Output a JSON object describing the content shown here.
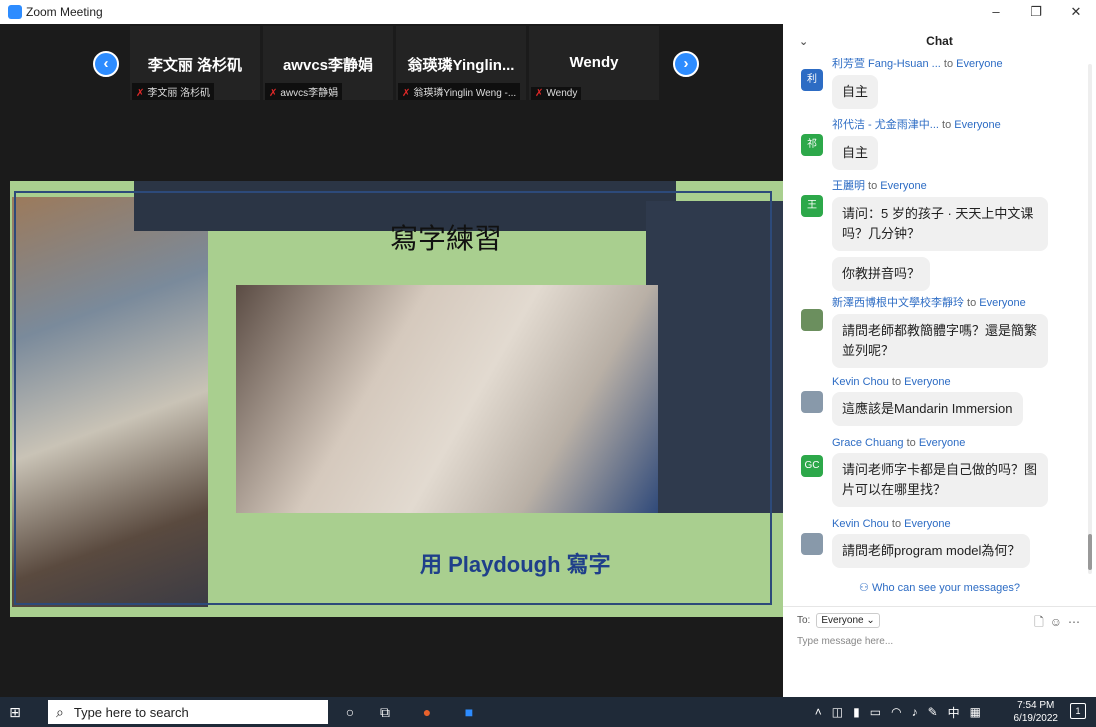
{
  "window": {
    "title": "Zoom Meeting",
    "min": "–",
    "restore": "❐",
    "close": "✕"
  },
  "participants": [
    {
      "name": "李文丽 洛杉矶",
      "label": "李文丽 洛杉矶"
    },
    {
      "name": "awvcs李静娟",
      "label": "awvcs李静娟"
    },
    {
      "name": "翁瑛璘Yinglin...",
      "label": "翁瑛璘Yinglin Weng -..."
    },
    {
      "name": "Wendy",
      "label": "Wendy"
    }
  ],
  "slide": {
    "title": "寫字練習",
    "caption": "用 Playdough 寫字"
  },
  "chat": {
    "title": "Chat",
    "messages": [
      {
        "sender": "利芳萱 Fang-Hsuan ...",
        "to": " to ",
        "recipient": "Everyone",
        "avatar": "利",
        "avatar_color": "#2d6cc4",
        "text": "自主"
      },
      {
        "sender": "祁代洁 - 尤金雨津中...",
        "to": " to ",
        "recipient": "Everyone",
        "avatar": "祁",
        "avatar_color": "#2da84a",
        "text": "自主"
      },
      {
        "sender": "王麗明",
        "to": " to ",
        "recipient": "Everyone",
        "avatar": "王",
        "avatar_color": "#2da84a",
        "text": "请问：5 岁的孩子 · 天天上中文课吗？几分钟？",
        "text2": "你教拼音吗？"
      },
      {
        "sender": "新澤西博根中文學校李靜玲",
        "to": " to ",
        "recipient": "Everyone",
        "avatar": "",
        "avatar_color": "#6b8f5e",
        "text": "請問老師都教簡體字嗎？還是簡繁並列呢？"
      },
      {
        "sender": "Kevin Chou",
        "to": " to ",
        "recipient": "Everyone",
        "avatar": "",
        "avatar_color": "#8899aa",
        "text": "這應該是Mandarin Immersion"
      },
      {
        "sender": "Grace Chuang",
        "to": " to ",
        "recipient": "Everyone",
        "avatar": "GC",
        "avatar_color": "#2da84a",
        "text": "请问老师字卡都是自己做的吗？图片可以在哪里找？"
      },
      {
        "sender": "Kevin Chou",
        "to": " to ",
        "recipient": "Everyone",
        "avatar": "",
        "avatar_color": "#8899aa",
        "text": "請問老師program model為何？"
      }
    ],
    "who_can_see": "Who can see your messages?",
    "to_label": "To:",
    "to_value": "Everyone",
    "placeholder": "Type message here..."
  },
  "taskbar": {
    "search_placeholder": "Type here to search",
    "time": "7:54 PM",
    "date": "6/19/2022",
    "ime": "中",
    "notif_count": "1"
  }
}
